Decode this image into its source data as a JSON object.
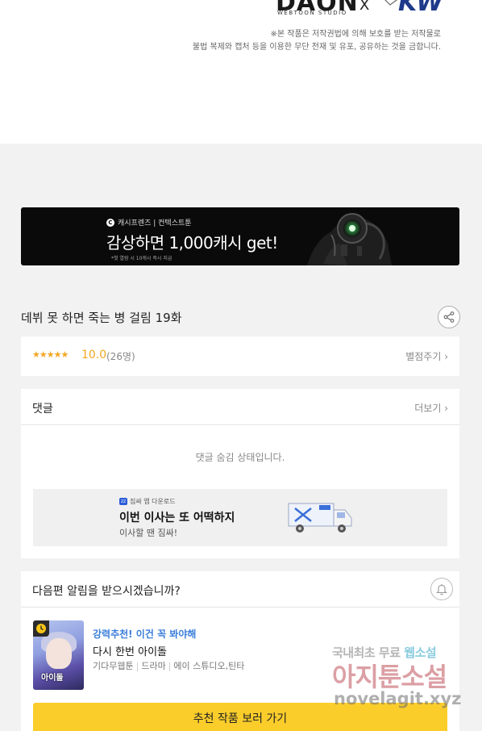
{
  "header": {
    "logo_daon": "DAON",
    "logo_daon_sub": "WEBTOON STUDIO",
    "logo_x": "X",
    "logo_kw": "KW",
    "notice_line1": "※본 작품은 저작권법에 의해 보호를 받는 저작물로",
    "notice_line2": "불법 복제와 캡처 등을 이용한 무단 전재 및 유포, 공유하는 것을 금합니다."
  },
  "banner": {
    "brand": "캐시프렌즈 | 컨텍스트툰",
    "brand_icon": "C",
    "main_text": "감상하면 1,000캐시 get!",
    "small_text": "*첫 열람 시 10캐시 즉시 지급"
  },
  "episode": {
    "title": "데뷔 못 하면 죽는 병 걸림 19화"
  },
  "rating": {
    "stars": "★★★★★",
    "score": "10.0",
    "count": "(26명)",
    "rate_link": "별점주기 ›"
  },
  "comments": {
    "title": "댓글",
    "more_link": "더보기 ›",
    "hidden_message": "댓글 숨김 상태입니다."
  },
  "ad": {
    "small": "짐싸 앱 다운로드",
    "title": "이번 이사는 또 어떡하지",
    "subtitle": "이사할 땐 짐싸!"
  },
  "notify": {
    "title": "다음편 알림을 받으시겠습니까?"
  },
  "recommend": {
    "thumb_text": "아이돌",
    "tag": "강력추천! 이건 꼭 봐야해",
    "name": "다시 한번 아이돌",
    "meta": [
      "기다무웹툰",
      "드라마",
      "에이 스튜디오,틴타"
    ],
    "button": "추천 작품 보러 가기"
  },
  "watermark": {
    "line1a": "국내최초 무료",
    "line1b": "웹소설",
    "line2": "아지툰소설",
    "line3": "novelagit.xyz"
  },
  "colors": {
    "accent_star": "#f5a623",
    "recommend_tag": "#3b7ddb",
    "button_yellow": "#fbcd2b"
  }
}
